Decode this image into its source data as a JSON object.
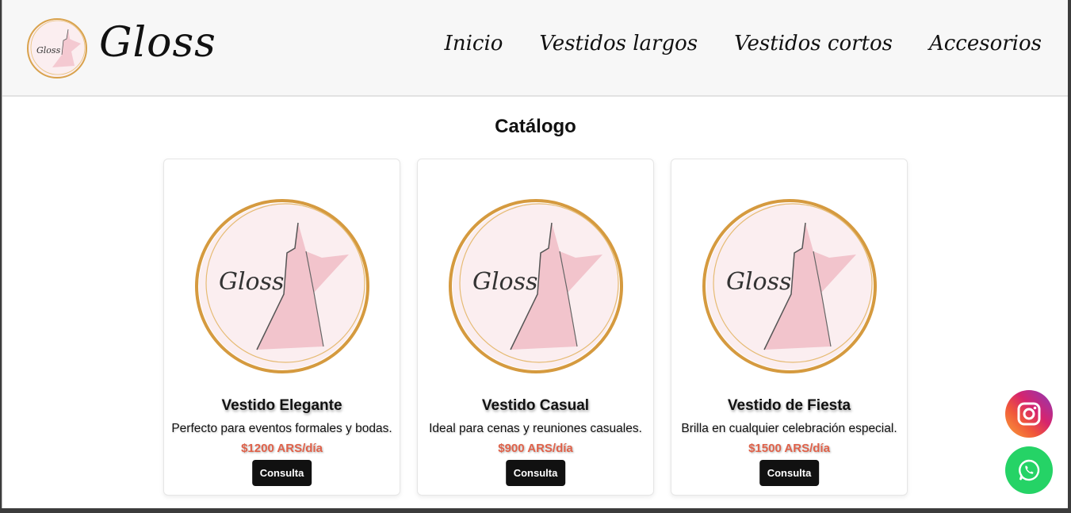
{
  "brand": {
    "name": "Gloss",
    "logo_icon": "dress-logo-icon",
    "logo_text": "Gloss"
  },
  "nav": {
    "items": [
      {
        "label": "Inicio"
      },
      {
        "label": "Vestidos largos"
      },
      {
        "label": "Vestidos cortos"
      },
      {
        "label": "Accesorios"
      }
    ]
  },
  "catalog": {
    "title": "Catálogo",
    "cards": [
      {
        "title": "Vestido Elegante",
        "description": "Perfecto para eventos formales y bodas.",
        "price": "$1200 ARS/día",
        "button": "Consulta",
        "image_icon": "dress-logo-icon"
      },
      {
        "title": "Vestido Casual",
        "description": "Ideal para cenas y reuniones casuales.",
        "price": "$900 ARS/día",
        "button": "Consulta",
        "image_icon": "dress-logo-icon"
      },
      {
        "title": "Vestido de Fiesta",
        "description": "Brilla en cualquier celebración especial.",
        "price": "$1500 ARS/día",
        "button": "Consulta",
        "image_icon": "dress-logo-icon"
      }
    ]
  },
  "floating": {
    "instagram_icon": "instagram-icon",
    "whatsapp_icon": "whatsapp-icon"
  },
  "colors": {
    "price": "#e0624a",
    "button_bg": "#111111",
    "whatsapp": "#25d366",
    "instagram_gradient": [
      "#f9a23a",
      "#d6246e",
      "#8a3ab9"
    ],
    "header_bg": "#f7f7f7"
  }
}
